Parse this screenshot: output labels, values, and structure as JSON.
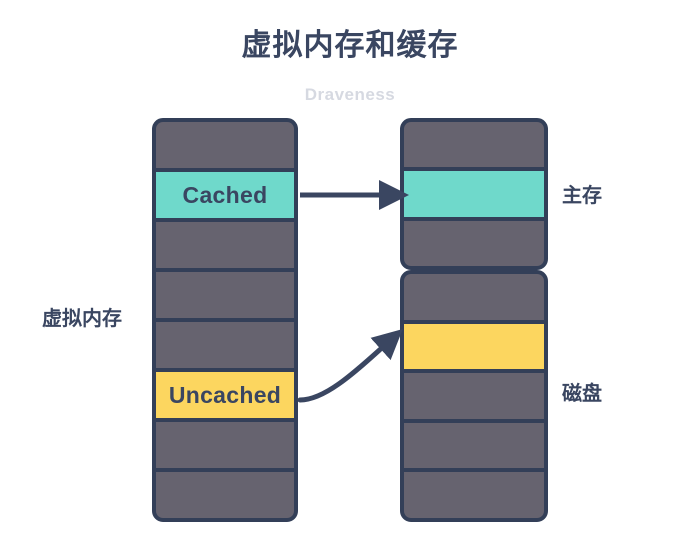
{
  "header": {
    "title": "虚拟内存和缓存",
    "subtitle": "Draveness"
  },
  "labels": {
    "virtual_memory": "虚拟内存",
    "main_memory": "主存",
    "disk": "磁盘"
  },
  "colors": {
    "background": "#ffffff",
    "ink": "#3A4661",
    "border": "#333F58",
    "cell_gray": "#66636F",
    "cached_teal": "#6FD9CB",
    "uncached_yellow": "#FCD65F",
    "subtitle_gray": "#D6D9E1"
  },
  "columns": {
    "virtual_memory": {
      "name": "虚拟内存",
      "cell_count": 8,
      "cells": [
        {
          "index": 0,
          "state": "gray",
          "label": ""
        },
        {
          "index": 1,
          "state": "teal",
          "label": "Cached"
        },
        {
          "index": 2,
          "state": "gray",
          "label": ""
        },
        {
          "index": 3,
          "state": "gray",
          "label": ""
        },
        {
          "index": 4,
          "state": "gray",
          "label": ""
        },
        {
          "index": 5,
          "state": "yellow",
          "label": "Uncached"
        },
        {
          "index": 6,
          "state": "gray",
          "label": ""
        },
        {
          "index": 7,
          "state": "gray",
          "label": ""
        }
      ]
    },
    "main_memory": {
      "name": "主存",
      "cell_count": 3,
      "cells": [
        {
          "index": 0,
          "state": "gray",
          "label": ""
        },
        {
          "index": 1,
          "state": "teal",
          "label": ""
        },
        {
          "index": 2,
          "state": "gray",
          "label": ""
        }
      ]
    },
    "disk": {
      "name": "磁盘",
      "cell_count": 5,
      "cells": [
        {
          "index": 0,
          "state": "gray",
          "label": ""
        },
        {
          "index": 1,
          "state": "yellow",
          "label": ""
        },
        {
          "index": 2,
          "state": "gray",
          "label": ""
        },
        {
          "index": 3,
          "state": "gray",
          "label": ""
        },
        {
          "index": 4,
          "state": "gray",
          "label": ""
        }
      ]
    }
  },
  "arrows": [
    {
      "name": "cached-to-main-memory",
      "shape": "straight",
      "from": "虚拟内存 Cached",
      "to": "主存"
    },
    {
      "name": "uncached-to-disk",
      "shape": "curved",
      "from": "虚拟内存 Uncached",
      "to": "磁盘"
    }
  ]
}
